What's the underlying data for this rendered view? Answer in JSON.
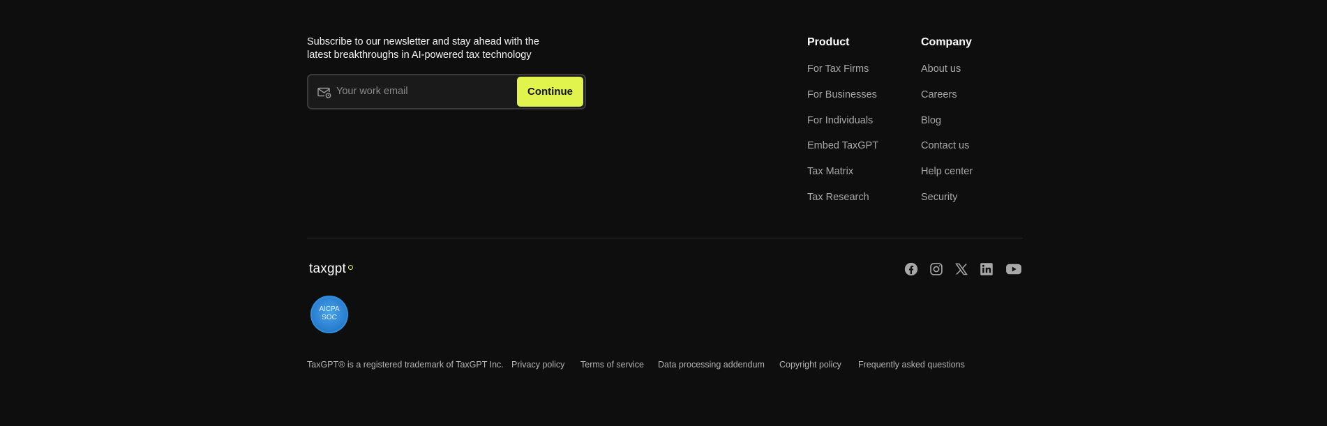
{
  "newsletter": {
    "text": "Subscribe to our newsletter and stay ahead with the latest breakthroughs in AI-powered tax technology",
    "email_placeholder": "Your work email",
    "button_label": "Continue"
  },
  "columns": [
    {
      "title": "Product",
      "links": [
        "For Tax Firms",
        "For Businesses",
        "For Individuals",
        "Embed TaxGPT",
        "Tax Matrix",
        "Tax Research"
      ]
    },
    {
      "title": "Company",
      "links": [
        "About us",
        "Careers",
        "Blog",
        "Contact us",
        "Help center",
        "Security"
      ]
    }
  ],
  "brand": {
    "logo_text": "taxgpt",
    "badge_line1": "AICPA",
    "badge_line2": "SOC",
    "accent_color": "#e1f44d"
  },
  "socials": [
    "facebook-icon",
    "instagram-icon",
    "x-icon",
    "linkedin-icon",
    "youtube-icon"
  ],
  "legal": {
    "trademark": "TaxGPT® is a registered trademark of TaxGPT Inc.",
    "links": [
      "Privacy policy",
      "Terms of service",
      "Data processing addendum",
      "Copyright policy",
      "Frequently asked questions"
    ]
  }
}
